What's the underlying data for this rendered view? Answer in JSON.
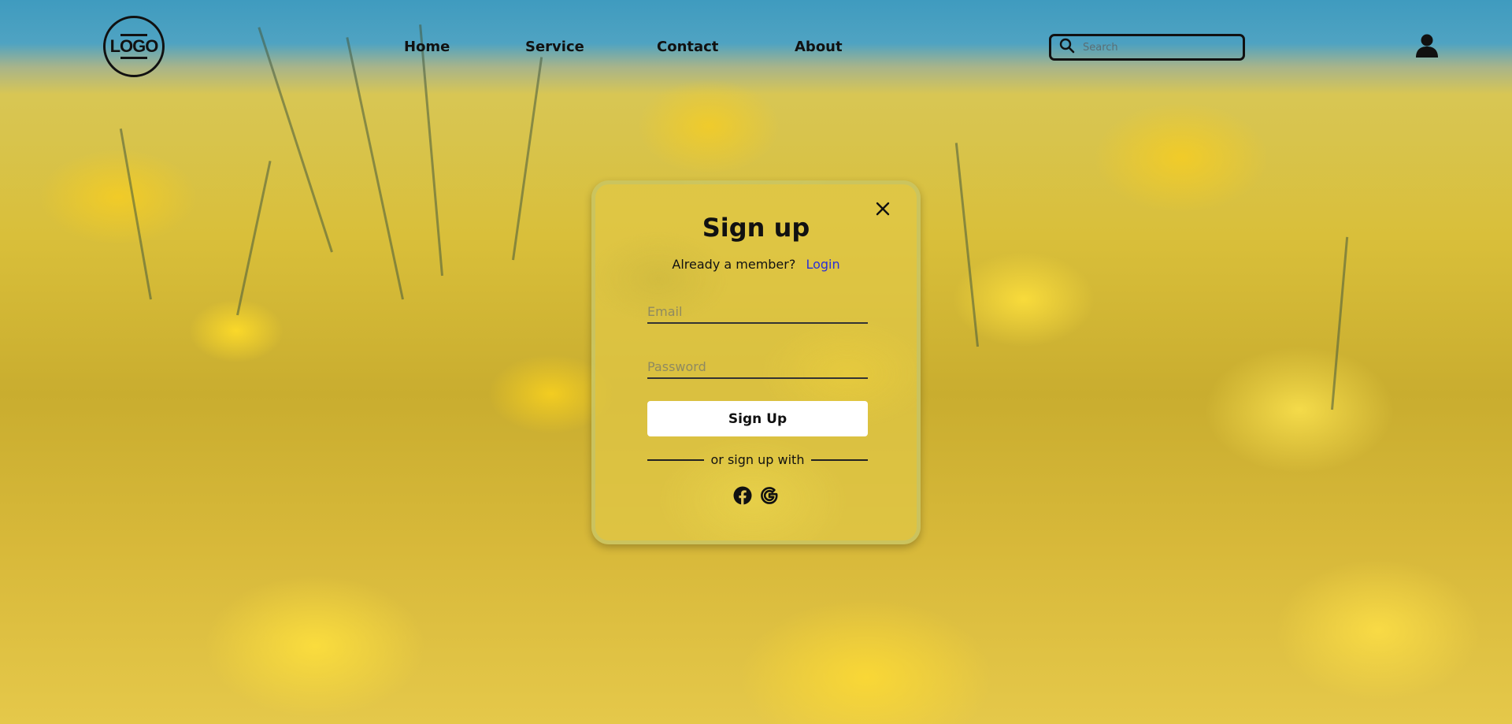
{
  "header": {
    "logo_text": "LOGO",
    "nav": [
      "Home",
      "Service",
      "Contact",
      "About"
    ],
    "search_placeholder": "Search"
  },
  "modal": {
    "title": "Sign up",
    "member_prompt": "Already a member?",
    "login_link": "Login",
    "email_placeholder": "Email",
    "password_placeholder": "Password",
    "submit_label": "Sign Up",
    "divider_text": "or sign up with",
    "social_icons": [
      "facebook-icon",
      "google-icon"
    ]
  },
  "colors": {
    "accent_link": "#2a2fd6",
    "text": "#111111",
    "button_bg": "#ffffff"
  }
}
